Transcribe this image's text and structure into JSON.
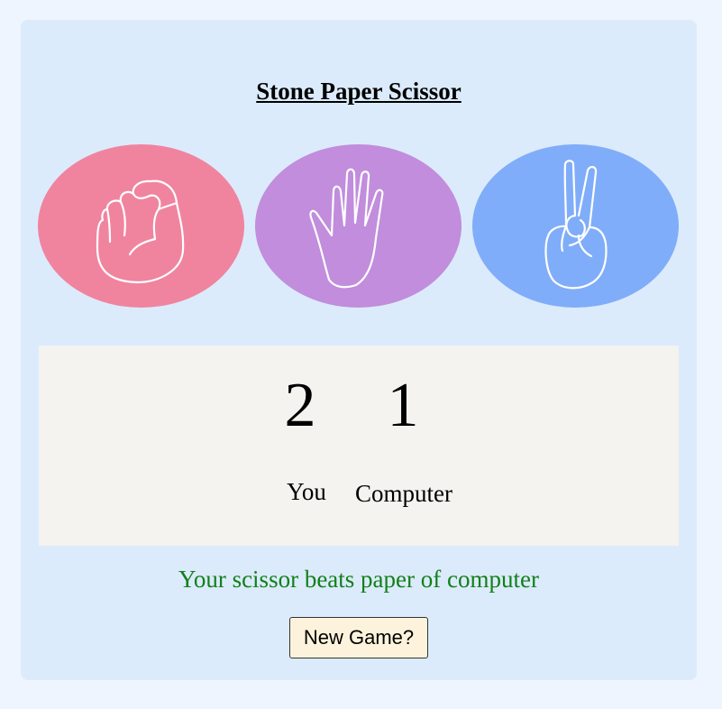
{
  "game": {
    "title": "Stone Paper Scissor"
  },
  "choices": [
    {
      "id": "stone",
      "icon": "fist-icon",
      "color": "#f0849f"
    },
    {
      "id": "paper",
      "icon": "open-hand-icon",
      "color": "#c18ddc"
    },
    {
      "id": "scissor",
      "icon": "peace-sign-icon",
      "color": "#80adf9"
    }
  ],
  "score": {
    "user": "2",
    "computer": "1",
    "user_label": "You",
    "computer_label": "Computer"
  },
  "result": {
    "message": "Your scissor beats paper of computer",
    "color": "#11801b"
  },
  "actions": {
    "new_game_label": "New Game?"
  }
}
